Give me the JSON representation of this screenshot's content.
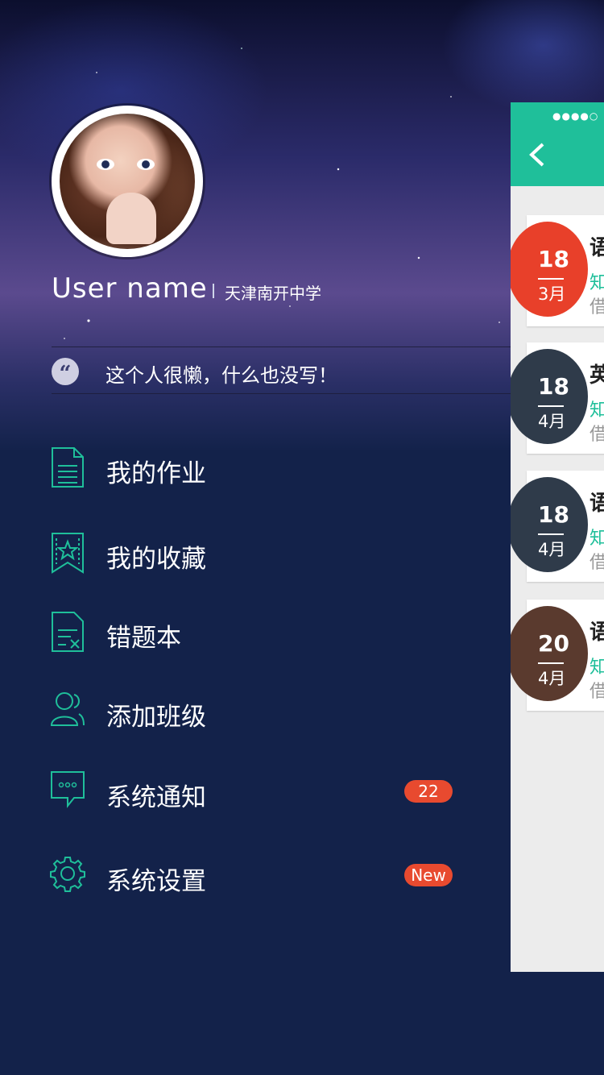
{
  "profile": {
    "user_name": "User name",
    "school": "天津南开中学",
    "signature": "这个人很懒，什么也没写！",
    "quote_icon": "quote-icon"
  },
  "menu": {
    "items": [
      {
        "label": "我的作业",
        "icon": "document-icon",
        "badge": ""
      },
      {
        "label": "我的收藏",
        "icon": "bookmark-star-icon",
        "badge": ""
      },
      {
        "label": "错题本",
        "icon": "wrong-answer-book-icon",
        "badge": ""
      },
      {
        "label": "添加班级",
        "icon": "add-class-users-icon",
        "badge": ""
      },
      {
        "label": "系统通知",
        "icon": "message-bubble-icon",
        "badge": "22"
      },
      {
        "label": "系统设置",
        "icon": "gear-icon",
        "badge": "New"
      }
    ]
  },
  "panel": {
    "status_dots": "●●●●○",
    "back_icon": "chevron-left-icon",
    "cards": [
      {
        "day": "18",
        "month": "3月",
        "subject": "语",
        "tag": "知",
        "info": "借",
        "color": "#e8402a"
      },
      {
        "day": "18",
        "month": "4月",
        "subject": "英",
        "tag": "知",
        "info": "借",
        "color": "#2f3b4a"
      },
      {
        "day": "18",
        "month": "4月",
        "subject": "语",
        "tag": "知",
        "info": "借",
        "color": "#2f3b4a"
      },
      {
        "day": "20",
        "month": "4月",
        "subject": "语",
        "tag": "知",
        "info": "借",
        "color": "#5a3a2e"
      }
    ]
  },
  "colors": {
    "accent": "#1fbf9a",
    "badge": "#e84a2f",
    "background": "#13224a"
  }
}
